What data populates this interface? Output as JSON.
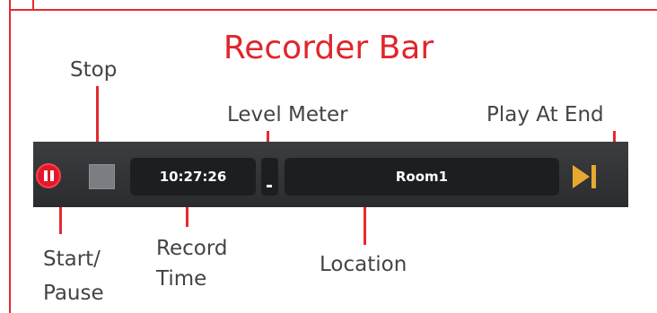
{
  "title": "Recorder Bar",
  "callouts": {
    "stop": "Stop",
    "level_meter": "Level Meter",
    "play_at_end": "Play At End",
    "start_pause": "Start/\nPause",
    "record_time": "Record\nTime",
    "location": "Location"
  },
  "recorder": {
    "record_time": "10:27:26",
    "location": "Room1",
    "level": 0
  },
  "colors": {
    "accent": "#e32a31",
    "bar_background": "#333436",
    "pause_button": "#e2192b",
    "play_icon": "#e8a830"
  },
  "icons": {
    "start_pause": "pause-icon",
    "stop": "stop-icon",
    "play_at_end": "skip-to-end-icon"
  }
}
